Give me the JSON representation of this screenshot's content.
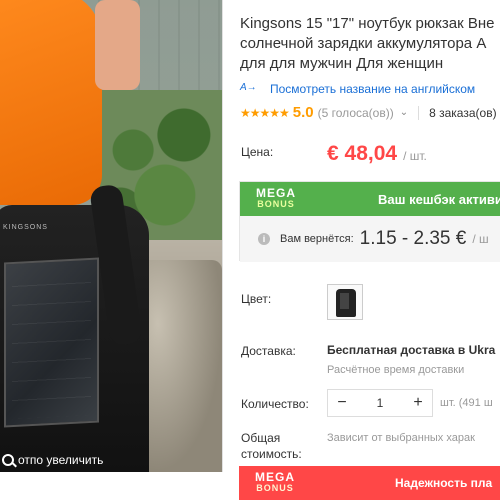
{
  "gallery": {
    "zoom_hint": "отпо увеличить",
    "backpack_logo": "KINGSONS"
  },
  "product": {
    "title_lines": [
      "Kingsons 15 \"17\" ноутбук рюкзак Вне",
      "солнечной зарядки аккумулятора А",
      "для для мужчин Для женщин"
    ],
    "translate_icon": "A→",
    "translate_link": "Посмотреть название на английском",
    "rating": {
      "stars": "★★★★★",
      "score": "5.0",
      "votes": "(5 голоса(ов))",
      "chevron": "⌄",
      "orders": "8 заказа(ов)"
    }
  },
  "price": {
    "label": "Цена:",
    "value": "€ 48,04",
    "unit": "/ шт."
  },
  "mega_bonus": {
    "logo_top": "MEGA",
    "logo_bottom": "BONUS",
    "text": "Ваш кешбэк активи",
    "cashback_label": "Вам вернётся:",
    "cashback_range": "1.15 - 2.35 €",
    "cashback_unit": "/ ш",
    "info_icon": "i"
  },
  "color": {
    "label": "Цвет:"
  },
  "shipping": {
    "label": "Доставка:",
    "value": "Бесплатная доставка в Ukra",
    "estimate": "Расчётное время доставки"
  },
  "quantity": {
    "label": "Количество:",
    "minus": "−",
    "value": "1",
    "plus": "+",
    "unit": "шт. (491 ш"
  },
  "total": {
    "label_line1": "Общая",
    "label_line2": "стоимость:",
    "value": "Зависит от выбранных харак"
  },
  "mega_bonus_2": {
    "logo_top": "MEGA",
    "logo_bottom": "BONUS",
    "text": "Надежность пла"
  },
  "colors": {
    "price_red": "#ff4747",
    "mega_green": "#54b04c",
    "star_orange": "#ff9c00",
    "link_blue": "#1a6fd6"
  }
}
